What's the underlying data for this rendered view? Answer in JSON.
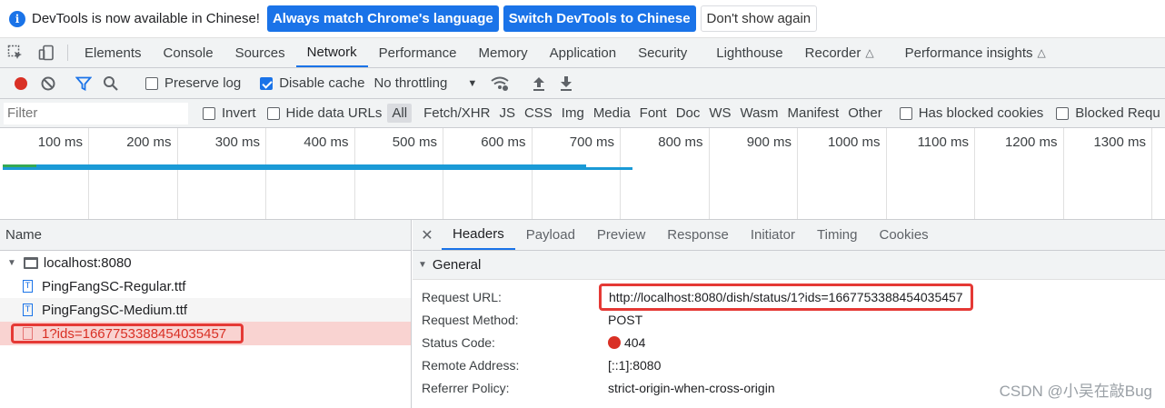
{
  "infobar": {
    "text": "DevTools is now available in Chinese!",
    "btn_match": "Always match Chrome's language",
    "btn_switch": "Switch DevTools to Chinese",
    "btn_dont": "Don't show again"
  },
  "tabs": {
    "items": [
      "Elements",
      "Console",
      "Sources",
      "Network",
      "Performance",
      "Memory",
      "Application",
      "Security",
      "Lighthouse",
      "Recorder",
      "Performance insights"
    ],
    "active": "Network"
  },
  "toolbar": {
    "preserve_log": "Preserve log",
    "preserve_log_checked": false,
    "disable_cache": "Disable cache",
    "disable_cache_checked": true,
    "throttling": "No throttling"
  },
  "filter": {
    "placeholder": "Filter",
    "invert": "Invert",
    "hide_data_urls": "Hide data URLs",
    "types": [
      "All",
      "Fetch/XHR",
      "JS",
      "CSS",
      "Img",
      "Media",
      "Font",
      "Doc",
      "WS",
      "Wasm",
      "Manifest",
      "Other"
    ],
    "active_type": "All",
    "has_blocked_cookies": "Has blocked cookies",
    "blocked_requests": "Blocked Requ"
  },
  "timeline": {
    "ticks": [
      "100 ms",
      "200 ms",
      "300 ms",
      "400 ms",
      "500 ms",
      "600 ms",
      "700 ms",
      "800 ms",
      "900 ms",
      "1000 ms",
      "1100 ms",
      "1200 ms",
      "1300 ms"
    ]
  },
  "requests": {
    "header": "Name",
    "group": "localhost:8080",
    "files": [
      "PingFangSC-Regular.ttf",
      "PingFangSC-Medium.ttf"
    ],
    "error_item": "1?ids=1667753388454035457"
  },
  "details": {
    "tabs": [
      "Headers",
      "Payload",
      "Preview",
      "Response",
      "Initiator",
      "Timing",
      "Cookies"
    ],
    "active_tab": "Headers",
    "section": "General",
    "rows": [
      {
        "key": "Request URL:",
        "value": "http://localhost:8080/dish/status/1?ids=1667753388454035457"
      },
      {
        "key": "Request Method:",
        "value": "POST"
      },
      {
        "key": "Status Code:",
        "value": "404"
      },
      {
        "key": "Remote Address:",
        "value": "[::1]:8080"
      },
      {
        "key": "Referrer Policy:",
        "value": "strict-origin-when-cross-origin"
      }
    ]
  },
  "watermark": "CSDN @小吴在敲Bug",
  "colors": {
    "accent": "#1a73e8",
    "error": "#d93025",
    "highlight_box": "#e53935",
    "error_row_bg": "#f9d3d1"
  }
}
